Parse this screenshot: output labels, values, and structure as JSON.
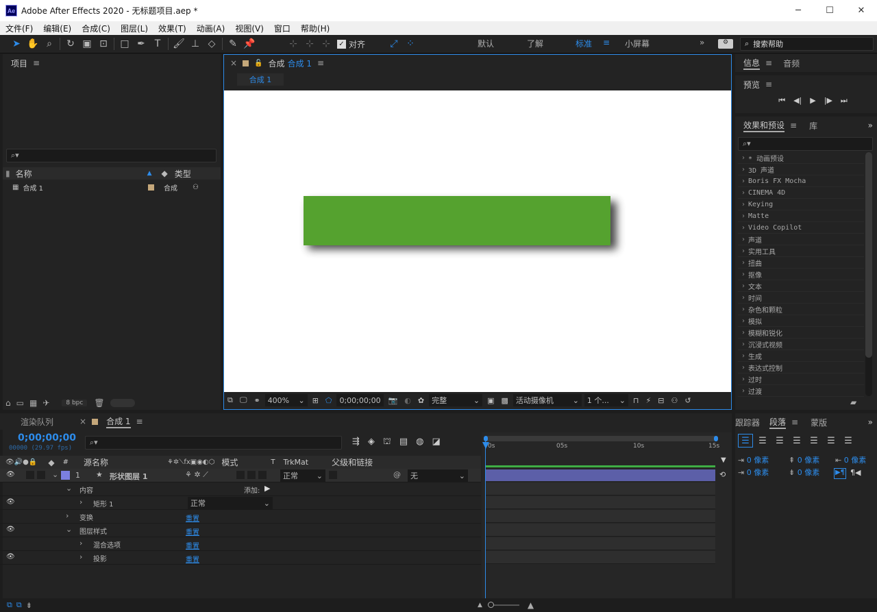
{
  "window": {
    "title": "Adobe After Effects 2020 - 无标题项目.aep *",
    "logo": "Ae"
  },
  "menu": [
    "文件(F)",
    "编辑(E)",
    "合成(C)",
    "图层(L)",
    "效果(T)",
    "动画(A)",
    "视图(V)",
    "窗口",
    "帮助(H)"
  ],
  "toolbar": {
    "snap_label": "对齐",
    "workspaces": [
      "默认",
      "了解",
      "标准",
      "小屏幕"
    ],
    "active_workspace": "标准",
    "search_placeholder": "搜索帮助"
  },
  "project": {
    "title": "项目",
    "col_name": "名称",
    "col_type": "类型",
    "items": [
      {
        "name": "合成 1",
        "type": "合成"
      }
    ],
    "bpc": "8 bpc"
  },
  "composition": {
    "tab_prefix": "合成",
    "tab_name": "合成 1",
    "breadcrumb": "合成 1",
    "rect_color": "#55a22f",
    "zoom": "400%",
    "timecode": "0;00;00;00",
    "resolution": "完整",
    "camera": "活动摄像机",
    "views": "1 个..."
  },
  "right": {
    "info_tab": "信息",
    "audio_tab": "音频",
    "preview_title": "预览",
    "effects_tab": "效果和预设",
    "library_tab": "库",
    "effects": [
      "* 动画预设",
      "3D 声道",
      "Boris FX Mocha",
      "CINEMA 4D",
      "Keying",
      "Matte",
      "Video Copilot",
      "声道",
      "实用工具",
      "扭曲",
      "抠像",
      "文本",
      "时间",
      "杂色和颗粒",
      "模拟",
      "模糊和锐化",
      "沉浸式视频",
      "生成",
      "表达式控制",
      "过时",
      "过渡"
    ]
  },
  "timeline": {
    "render_tab": "渲染队列",
    "comp_tab": "合成 1",
    "timecode": "0;00;00;00",
    "fps": "00000 (29.97 fps)",
    "cols": {
      "num": "#",
      "source": "源名称",
      "mode": "模式",
      "t": "T",
      "trkmat": "TrkMat",
      "parent": "父级和链接"
    },
    "layer": {
      "num": "1",
      "name": "形状图层 1",
      "mode": "正常",
      "parent": "无"
    },
    "props": {
      "contents": "内容",
      "add": "添加:",
      "rect": "矩形 1",
      "rect_mode": "正常",
      "transform": "变换",
      "reset": "重置",
      "layer_styles": "图层样式",
      "blend": "混合选项",
      "shadow": "投影"
    },
    "ruler": [
      "0s",
      "05s",
      "10s",
      "15s"
    ]
  },
  "paragraph": {
    "tracker_tab": "跟踪器",
    "para_tab": "段落",
    "mask_tab": "蒙版",
    "indent_values": [
      "0 像素",
      "0 像素",
      "0 像素",
      "0 像素",
      "0 像素"
    ]
  },
  "colors": {
    "accent": "#2d8ceb",
    "layer_bar": "#5c5fa8",
    "label": "#7b7fe0"
  }
}
